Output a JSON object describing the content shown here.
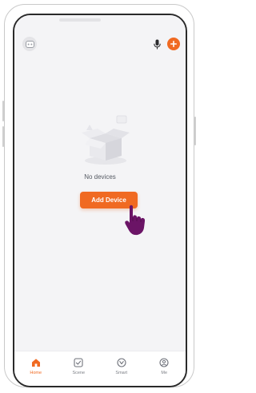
{
  "header": {
    "avatar_icon": "avatar-icon",
    "mic_icon": "microphone-icon",
    "add_icon": "plus-icon"
  },
  "empty_state": {
    "message": "No devices",
    "illustration": "empty-box-illustration",
    "add_device_label": "Add Device"
  },
  "tabbar": {
    "items": [
      {
        "label": "Home",
        "icon": "home-icon",
        "active": true
      },
      {
        "label": "Scene",
        "icon": "scene-icon",
        "active": false
      },
      {
        "label": "Smart",
        "icon": "smart-icon",
        "active": false
      },
      {
        "label": "Me",
        "icon": "me-icon",
        "active": false
      }
    ]
  },
  "colors": {
    "accent": "#f06a22",
    "background": "#f4f4f6",
    "pointer": "#6b1466"
  }
}
